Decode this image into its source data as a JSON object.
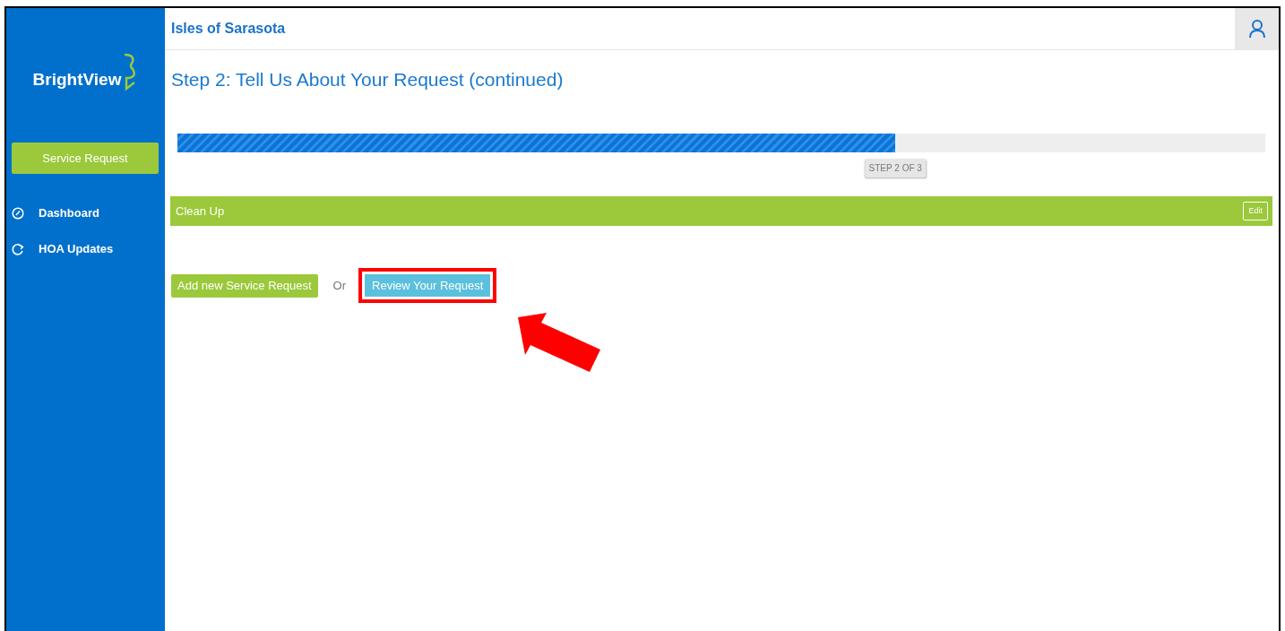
{
  "sidebar": {
    "logo": "BrightView",
    "primary_button": "Service Request",
    "items": [
      {
        "kind": "dashboard",
        "label": "Dashboard"
      },
      {
        "kind": "updates",
        "label": "HOA Updates"
      }
    ]
  },
  "header": {
    "title": "Isles of Sarasota"
  },
  "heading": "Step 2: Tell Us About Your Request (continued)",
  "progress": {
    "level": 0.66,
    "tooltip": "STEP 2 OF 3"
  },
  "section": {
    "title": "Clean Up",
    "button": "Edit"
  },
  "actions": {
    "add_button": "Add new Service Request",
    "separator": "Or",
    "review_button": "Review Your Request",
    "review_highlighted": true
  }
}
